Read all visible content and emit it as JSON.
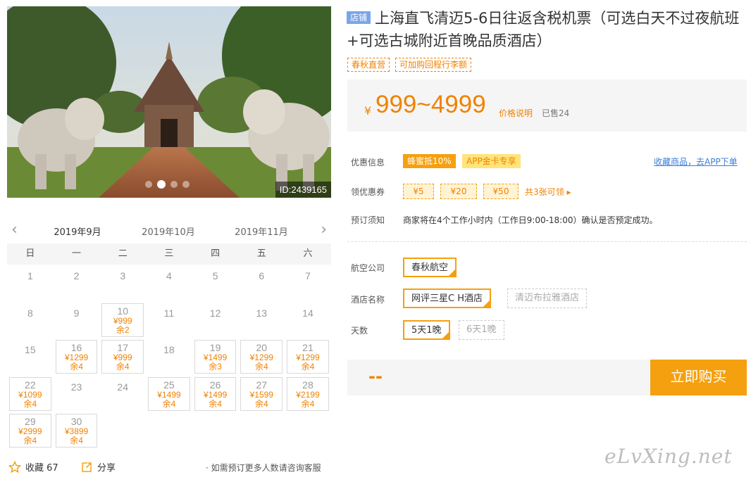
{
  "photo": {
    "id_text": "ID:2439165",
    "slide_count": 4,
    "active_slide": 2
  },
  "calendar": {
    "prev_icon": "chevron-left-icon",
    "next_icon": "chevron-right-icon",
    "months": [
      "2019年9月",
      "2019年10月",
      "2019年11月"
    ],
    "active_month": 0,
    "weekdays": [
      "日",
      "一",
      "二",
      "三",
      "四",
      "五",
      "六"
    ],
    "days": [
      {
        "d": "1"
      },
      {
        "d": "2"
      },
      {
        "d": "3"
      },
      {
        "d": "4"
      },
      {
        "d": "5"
      },
      {
        "d": "6"
      },
      {
        "d": "7"
      },
      {
        "d": "8"
      },
      {
        "d": "9"
      },
      {
        "d": "10",
        "price": "¥999",
        "stock": "余2"
      },
      {
        "d": "11"
      },
      {
        "d": "12"
      },
      {
        "d": "13"
      },
      {
        "d": "14"
      },
      {
        "d": "15"
      },
      {
        "d": "16",
        "price": "¥1299",
        "stock": "余4"
      },
      {
        "d": "17",
        "price": "¥999",
        "stock": "余4"
      },
      {
        "d": "18"
      },
      {
        "d": "19",
        "price": "¥1499",
        "stock": "余3"
      },
      {
        "d": "20",
        "price": "¥1299",
        "stock": "余4"
      },
      {
        "d": "21",
        "price": "¥1299",
        "stock": "余4"
      },
      {
        "d": "22",
        "price": "¥1099",
        "stock": "余4"
      },
      {
        "d": "23"
      },
      {
        "d": "24"
      },
      {
        "d": "25",
        "price": "¥1499",
        "stock": "余4"
      },
      {
        "d": "26",
        "price": "¥1499",
        "stock": "余4"
      },
      {
        "d": "27",
        "price": "¥1599",
        "stock": "余4"
      },
      {
        "d": "28",
        "price": "¥2199",
        "stock": "余4"
      },
      {
        "d": "29",
        "price": "¥2999",
        "stock": "余4"
      },
      {
        "d": "30",
        "price": "¥3899",
        "stock": "余4"
      }
    ]
  },
  "footer": {
    "fav_icon": "star-icon",
    "fav_label": "收藏 67",
    "share_icon": "share-icon",
    "share_label": "分享",
    "consult": "· 如需预订更多人数请咨询客服"
  },
  "product": {
    "shop_badge": "店铺",
    "title": "上海直飞清迈5-6日往返含税机票（可选白天不过夜航班+可选古城附近首晚品质酒店）",
    "tags": [
      "春秋直营",
      "可加购回程行李额"
    ]
  },
  "price": {
    "currency": "¥",
    "value": "999~4999",
    "note": "价格说明",
    "sold": "已售24"
  },
  "labels": {
    "promo": "优惠信息",
    "coupons": "领优惠券",
    "notice": "预订须知",
    "airline": "航空公司",
    "hotel": "酒店名称",
    "days": "天数"
  },
  "promo": {
    "bee": "蜂蜜抵10%",
    "app": "APP金卡专享",
    "app_link": "收藏商品，去APP下单"
  },
  "coupons": {
    "items": [
      "¥5",
      "¥20",
      "¥50"
    ],
    "more": "共3张可领 ▸"
  },
  "notice_text": "商家将在4个工作小时内（工作日9:00-18:00）确认是否预定成功。",
  "options": {
    "airline": [
      "春秋航空"
    ],
    "hotel": [
      "网评三星C H酒店",
      "清迈布拉雅酒店"
    ],
    "days": [
      "5天1晚",
      "6天1晚"
    ]
  },
  "buy": {
    "total": "--",
    "button": "立即购买"
  },
  "watermark": "eLvXing.net",
  "colors": {
    "accent": "#f5a00f",
    "price": "#f08200",
    "link": "#3a7ed8"
  }
}
